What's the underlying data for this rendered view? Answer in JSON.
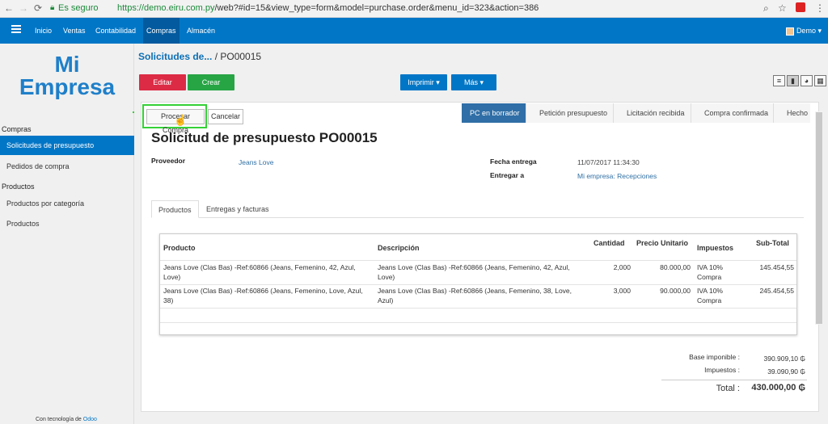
{
  "browser": {
    "secure_label": "Es seguro",
    "url_host": "https://demo.eiru.com.py",
    "url_path": "/web?#id=15&view_type=form&model=purchase.order&menu_id=323&action=386"
  },
  "topbar": {
    "menu": [
      "Inicio",
      "Ventas",
      "Contabilidad",
      "Compras",
      "Almacén"
    ],
    "user": "Demo"
  },
  "sidebar": {
    "logo_line1": "Mi",
    "logo_line2": "Empresa",
    "section_compras": "Compras",
    "items_compras": [
      "Solicitudes de presupuesto",
      "Pedidos de compra"
    ],
    "section_productos": "Productos",
    "items_productos": [
      "Productos por categoría",
      "Productos"
    ],
    "powered_prefix": "Con tecnología de",
    "powered_brand": "Odoo"
  },
  "breadcrumb": {
    "parent": "Solicitudes de...",
    "current": " / PO00015"
  },
  "toolbar": {
    "edit": "Editar",
    "create": "Crear",
    "print": "Imprimir ▾",
    "more": "Más ▾"
  },
  "actions": {
    "process": "Procesar Compra",
    "cancel": "Cancelar"
  },
  "stages": [
    "PC en borrador",
    "Petición presupuesto",
    "Licitación recibida",
    "Compra confirmada",
    "Hecho"
  ],
  "form": {
    "title": "Solicitud de presupuesto PO00015",
    "supplier_label": "Proveedor",
    "supplier": "Jeans Love",
    "date_label": "Fecha entrega",
    "date": "11/07/2017 11:34:30",
    "deliver_label": "Entregar a",
    "deliver": "Mi empresa: Recepciones"
  },
  "tabs": [
    "Productos",
    "Entregas y facturas"
  ],
  "table": {
    "headers": [
      "Producto",
      "Descripción",
      "Cantidad",
      "Precio Unitario",
      "Impuestos",
      "Sub-Total"
    ],
    "rows": [
      {
        "product_1": "Jeans Love (Clas Bas) -Ref:60866 (Jeans, Femenino, 42, Azul,",
        "product_2": "Love)",
        "desc_1": "Jeans Love (Clas Bas) -Ref:60866 (Jeans, Femenino, 42, Azul,",
        "desc_2": "Love)",
        "qty": "2,000",
        "price": "80.000,00",
        "tax_1": "IVA 10%",
        "tax_2": "Compra",
        "subtotal": "145.454,55"
      },
      {
        "product_1": "Jeans Love (Clas Bas) -Ref:60866 (Jeans, Femenino, Love, Azul,",
        "product_2": "38)",
        "desc_1": "Jeans Love (Clas Bas) -Ref:60866 (Jeans, Femenino, 38, Love,",
        "desc_2": "Azul)",
        "qty": "3,000",
        "price": "90.000,00",
        "tax_1": "IVA 10%",
        "tax_2": "Compra",
        "subtotal": "245.454,55"
      }
    ]
  },
  "totals": {
    "base_label": "Base imponible :",
    "base": "390.909,10 ₲",
    "tax_label": "Impuestos :",
    "tax": "39.090,90 ₲",
    "total_label": "Total :",
    "total": "430.000,00 ₲"
  },
  "colors": {
    "primary": "#0276c6",
    "danger": "#dc2b45",
    "success": "#27a545",
    "highlight": "#34d136"
  }
}
